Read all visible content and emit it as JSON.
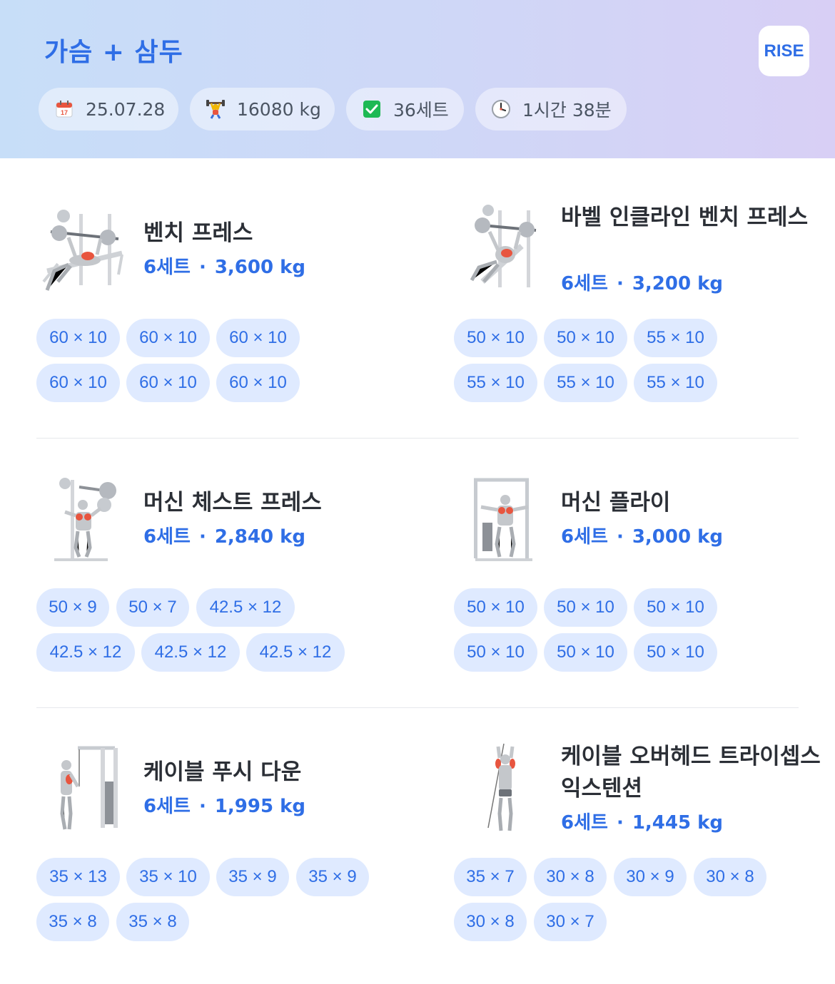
{
  "header": {
    "title": "가슴 + 삼두",
    "logo": "RISE",
    "stats": [
      {
        "icon": "calendar-icon",
        "value": "25.07.28"
      },
      {
        "icon": "weightlifter-icon",
        "value": "16080 kg"
      },
      {
        "icon": "checkbox-icon",
        "value": "36세트"
      },
      {
        "icon": "clock-icon",
        "value": "1시간 38분"
      }
    ]
  },
  "exercises": [
    {
      "name": "벤치 프레스",
      "sets": "6세트",
      "volume": "3,600 kg",
      "records": [
        "60 × 10",
        "60 × 10",
        "60 × 10",
        "60 × 10",
        "60 × 10",
        "60 × 10"
      ]
    },
    {
      "name": "바벨 인클라인 벤치 프레스",
      "sets": "6세트",
      "volume": "3,200 kg",
      "records": [
        "50 × 10",
        "50 × 10",
        "55 × 10",
        "55 × 10",
        "55 × 10",
        "55 × 10"
      ]
    },
    {
      "name": "머신 체스트 프레스",
      "sets": "6세트",
      "volume": "2,840 kg",
      "records": [
        "50 × 9",
        "50 × 7",
        "42.5 × 12",
        "42.5 × 12",
        "42.5 × 12",
        "42.5 × 12"
      ]
    },
    {
      "name": "머신 플라이",
      "sets": "6세트",
      "volume": "3,000 kg",
      "records": [
        "50 × 10",
        "50 × 10",
        "50 × 10",
        "50 × 10",
        "50 × 10",
        "50 × 10"
      ]
    },
    {
      "name": "케이블 푸시 다운",
      "sets": "6세트",
      "volume": "1,995 kg",
      "records": [
        "35 × 13",
        "35 × 10",
        "35 × 9",
        "35 × 9",
        "35 × 8",
        "35 × 8"
      ]
    },
    {
      "name": "케이블 오버헤드 트라이셉스 익스텐션",
      "sets": "6세트",
      "volume": "1,445 kg",
      "records": [
        "35 × 7",
        "30 × 8",
        "30 × 9",
        "30 × 8",
        "30 × 8",
        "30 × 7"
      ]
    }
  ],
  "colors": {
    "accent": "#2f6ee6",
    "chip_bg": "#dfeaff",
    "muscle": "#e8553f"
  }
}
